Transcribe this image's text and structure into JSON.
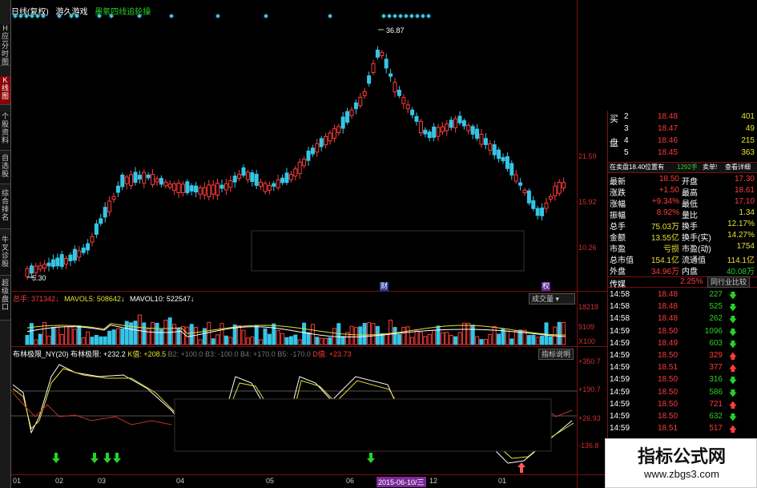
{
  "nav": {
    "tabs": [
      "H应用",
      "分时图",
      "K线图",
      "个股资料",
      "自选股",
      "综合排名",
      "牛叉诊股",
      "超级盘口"
    ]
  },
  "title": {
    "period": "日线(复权)",
    "name": "游久游戏",
    "signal": "墨氧四线追轮操"
  },
  "price_axis": [
    "21.59",
    "15.92",
    "10.26"
  ],
  "price_high_label": "36.87",
  "price_low_label": "5.30",
  "event_markers": [
    "财",
    "权"
  ],
  "volume": {
    "total_label": "总手: 371342",
    "mavol5": "MAVOL5: 508642",
    "mavol10": "MAVOL10: 522547",
    "button": "成交量",
    "axis": [
      "18218",
      "9109",
      "X100"
    ]
  },
  "indicator": {
    "name": "布林极限_NY(20)",
    "bollinger": "布林极限: +232.2",
    "k": "K值: +208.5",
    "b2": "B2: +100.0",
    "b3": "B3: -100.0",
    "b4": "B4: +170.0",
    "b5": "B5: -170.0",
    "d": "D值: +23.73",
    "button": "指标说明",
    "axis": [
      "+350.7",
      "+190.7",
      "+26.93",
      "-136.8"
    ]
  },
  "dates": [
    "01",
    "02",
    "03",
    "04",
    "05",
    "06",
    "2015-06-10/三",
    "12",
    "01"
  ],
  "quote": {
    "bids": [
      {
        "label": "买",
        "level": "2",
        "price": "18.48",
        "vol": "401"
      },
      {
        "label": "",
        "level": "3",
        "price": "18.47",
        "vol": "49"
      },
      {
        "label": "盘",
        "level": "4",
        "price": "18.46",
        "vol": "215"
      },
      {
        "label": "",
        "level": "5",
        "price": "18.45",
        "vol": "363"
      }
    ],
    "sell_bar": {
      "text": "在卖盘18.40位置有",
      "vol": "1292手",
      "b1": "卖单!",
      "b2": "查看详细"
    },
    "stats": [
      [
        "最新",
        "18.50",
        "开盘",
        "17.30"
      ],
      [
        "涨跌",
        "+1.50",
        "最高",
        "18.61"
      ],
      [
        "涨幅",
        "+9.34%",
        "最低",
        "17.10"
      ],
      [
        "振幅",
        "8.92%",
        "量比",
        "1.34"
      ],
      [
        "总手",
        "75.03万",
        "换手",
        "12.17%"
      ],
      [
        "金额",
        "13.55亿",
        "换手(实)",
        "14.27%"
      ],
      [
        "市盈",
        "亏损",
        "市盈(动)",
        "1754"
      ],
      [
        "总市值",
        "154.1亿",
        "流通值",
        "114.1亿"
      ],
      [
        "外盘",
        "34.96万",
        "内盘",
        "40.08万"
      ]
    ],
    "industry": {
      "name": "传媒",
      "change": "2.25%",
      "button": "同行业比较"
    },
    "ticks": [
      {
        "time": "14:58",
        "price": "18.48",
        "vol": "227",
        "dir": "down"
      },
      {
        "time": "14:58",
        "price": "18.48",
        "vol": "525",
        "dir": "down"
      },
      {
        "time": "14:58",
        "price": "18.48",
        "vol": "262",
        "dir": "down"
      },
      {
        "time": "14:59",
        "price": "18.50",
        "vol": "1096",
        "dir": "down"
      },
      {
        "time": "14:59",
        "price": "18.49",
        "vol": "603",
        "dir": "down"
      },
      {
        "time": "14:59",
        "price": "18.50",
        "vol": "329",
        "dir": "up"
      },
      {
        "time": "14:59",
        "price": "18.51",
        "vol": "377",
        "dir": "up"
      },
      {
        "time": "14:59",
        "price": "18.50",
        "vol": "316",
        "dir": "down"
      },
      {
        "time": "14:59",
        "price": "18.50",
        "vol": "586",
        "dir": "down"
      },
      {
        "time": "14:59",
        "price": "18.50",
        "vol": "721",
        "dir": "up"
      },
      {
        "time": "14:59",
        "price": "18.50",
        "vol": "632",
        "dir": "down"
      },
      {
        "time": "14:59",
        "price": "18.51",
        "vol": "517",
        "dir": "up"
      }
    ]
  },
  "watermark": {
    "title": "指标公式网",
    "url": "www.zbgs3.com"
  },
  "colors": {
    "up": "#ff3b3b",
    "down": "#35c6e6",
    "grid": "#7a1010",
    "accent_green": "#27d127"
  }
}
